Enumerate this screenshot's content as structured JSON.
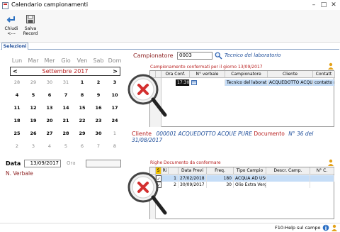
{
  "window": {
    "title": "Calendario campionamenti"
  },
  "toolbar": {
    "close_label": "Chiudi\n<---",
    "close_l1": "Chiudi",
    "close_l2": "<---",
    "save_l1": "Salva",
    "save_l2": "Record"
  },
  "tabs": [
    {
      "label": "Selezioni",
      "selected": true
    }
  ],
  "calendar": {
    "day_headers": [
      "Lun",
      "Mar",
      "Mer",
      "Gio",
      "Ven",
      "Sab",
      "Dom"
    ],
    "month_label": "Settembre 2017",
    "prev": "<",
    "next": ">",
    "weeks": [
      [
        "28",
        "29",
        "30",
        "31",
        "1",
        "2",
        "3"
      ],
      [
        "4",
        "5",
        "6",
        "7",
        "8",
        "9",
        "10"
      ],
      [
        "11",
        "12",
        "13",
        "14",
        "15",
        "16",
        "17"
      ],
      [
        "18",
        "19",
        "20",
        "21",
        "22",
        "23",
        "24"
      ],
      [
        "25",
        "26",
        "27",
        "28",
        "29",
        "30",
        "1"
      ],
      [
        "2",
        "3",
        "4",
        "5",
        "6",
        "7",
        "8"
      ]
    ]
  },
  "date_row": {
    "data_label": "Data",
    "data_value": "13/09/2017",
    "ora_label": "Ora",
    "ora_value": ""
  },
  "verbale_label": "N. Verbale",
  "campionatore": {
    "label": "Campionatore",
    "code": "0003",
    "name": "Tecnico del laboratorio"
  },
  "grid1": {
    "title": "Campionamento confermati per il giorno 13/09/2017",
    "columns": [
      "Ora Conf.",
      "N° verbale",
      "Campionatore",
      "Cliente",
      "Contatt"
    ],
    "rows": [
      {
        "ora": "17:30",
        "verbale": "",
        "campionatore": "Tecnico del laborat",
        "cliente": "ACQUEDOTTO ACQUE",
        "contatto": "contatto n5"
      }
    ]
  },
  "cliente": {
    "label": "Cliente",
    "value": "000001 ACQUEDOTTO ACQUE PURE",
    "doc_label": "Documento",
    "doc_value": "N° 36 del 31/08/2017"
  },
  "grid2": {
    "title": "Righe Documento da confermare",
    "columns": [
      "S",
      "Ri",
      "Data Previ",
      "Freq.",
      "Tipo Campio",
      "Descr. Camp.",
      "N° C."
    ],
    "rows": [
      {
        "sel": "✓",
        "ri": "1",
        "data": "27/02/2018",
        "freq": "180",
        "tipo": "ACQUA AD USO",
        "descr": ""
      },
      {
        "sel": "✓",
        "ri": "2",
        "data": "30/09/2017",
        "freq": "30",
        "tipo": "Olio Extra Vergi",
        "descr": ""
      }
    ]
  },
  "status": {
    "help": "F10:Help sul campo"
  },
  "colors": {
    "accent": "#1f4e9a",
    "red": "#b71c1c",
    "selection": "#c5ddf7"
  }
}
